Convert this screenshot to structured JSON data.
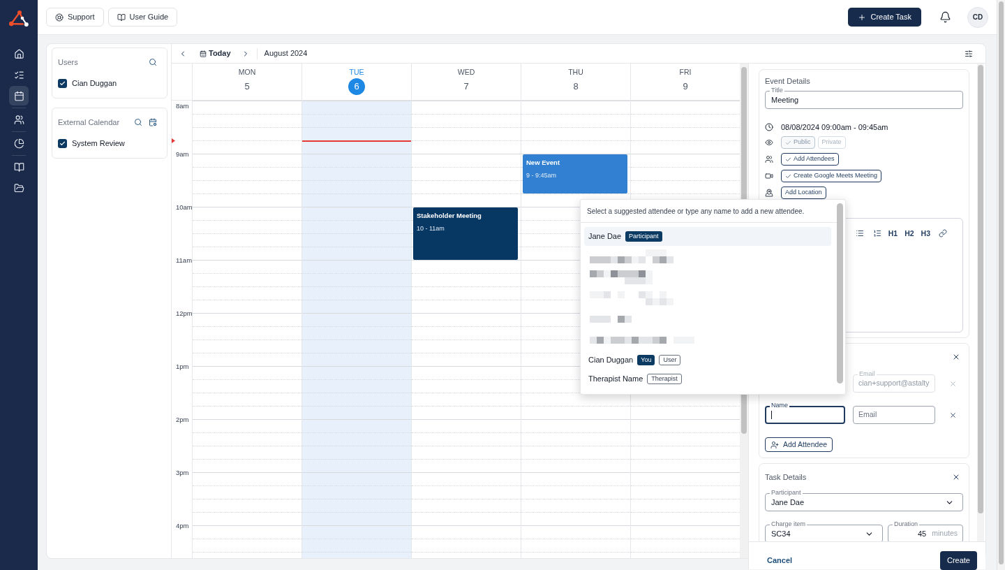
{
  "top_bar": {
    "links": [
      {
        "label": "Support"
      },
      {
        "label": "User Guide"
      }
    ],
    "create_button": "Create Task",
    "avatar": "CD"
  },
  "sidebar": {
    "groups": [
      [
        {
          "selected": false
        },
        {
          "selected": false
        },
        {
          "selected": true
        }
      ],
      [
        {
          "selected": false
        }
      ],
      [
        {
          "selected": false
        }
      ],
      [
        {
          "selected": false
        },
        {
          "selected": false
        }
      ]
    ]
  },
  "filters": [
    {
      "title": "Users",
      "items": [
        {
          "label": "Cian Duggan",
          "checked": true
        }
      ]
    },
    {
      "title": "External Calendar",
      "items": [
        {
          "label": "System Review",
          "checked": true
        }
      ]
    }
  ],
  "calendar": {
    "today_button": "Today",
    "month": "August 2024",
    "hours": [
      {
        "label": "8am",
        "quarters": [
          {
            "now": false
          },
          {
            "now": false
          },
          {
            "now": false
          },
          {
            "now": true
          }
        ]
      },
      {
        "label": "9am",
        "quarters": [
          {
            "now": false
          },
          {
            "now": false
          },
          {
            "now": false
          },
          {
            "now": false
          }
        ]
      },
      {
        "label": "10am",
        "quarters": [
          {
            "now": false
          },
          {
            "now": false
          },
          {
            "now": false
          },
          {
            "now": false
          }
        ]
      },
      {
        "label": "11am",
        "quarters": [
          {
            "now": false
          },
          {
            "now": false
          },
          {
            "now": false
          },
          {
            "now": false
          }
        ]
      },
      {
        "label": "12pm",
        "quarters": [
          {
            "now": false
          },
          {
            "now": false
          },
          {
            "now": false
          },
          {
            "now": false
          }
        ]
      },
      {
        "label": "1pm",
        "quarters": [
          {
            "now": false
          },
          {
            "now": false
          },
          {
            "now": false
          },
          {
            "now": false
          }
        ]
      },
      {
        "label": "2pm",
        "quarters": [
          {
            "now": false
          },
          {
            "now": false
          },
          {
            "now": false
          },
          {
            "now": false
          }
        ]
      },
      {
        "label": "3pm",
        "quarters": [
          {
            "now": false
          },
          {
            "now": false
          },
          {
            "now": false
          },
          {
            "now": false
          }
        ]
      },
      {
        "label": "4pm",
        "quarters": [
          {
            "now": false
          },
          {
            "now": false
          },
          {
            "now": false
          }
        ]
      }
    ],
    "days": [
      {
        "name": "MON",
        "date": "5",
        "today": false
      },
      {
        "name": "TUE",
        "date": "6",
        "today": true
      },
      {
        "name": "WED",
        "date": "7",
        "today": false,
        "events": [
          {
            "title": "Stakeholder Meeting",
            "time": "10 - 11am",
            "color": "#073763"
          }
        ]
      },
      {
        "name": "THU",
        "date": "8",
        "today": false,
        "events": [
          {
            "title": "New Event",
            "time": "9 - 9:45am",
            "color": "#3180d1"
          }
        ]
      },
      {
        "name": "FRI",
        "date": "9",
        "today": false
      }
    ]
  },
  "event_panel": {
    "event_details": {
      "heading": "Event Details",
      "title_field": {
        "label": "Title",
        "value": "Meeting"
      },
      "datetime": "08/08/2024 09:00am - 09:45am",
      "option_rows": [
        {
          "chips": [
            {
              "label": "Public",
              "selected": true,
              "disabled": true
            },
            {
              "label": "Private",
              "selected": false,
              "disabled": true
            }
          ]
        },
        {
          "chips": [
            {
              "label": "Add Attendees",
              "selected": true,
              "disabled": false
            }
          ]
        },
        {
          "chips": [
            {
              "label": "Create Google Meets Meeting",
              "selected": true,
              "disabled": false
            }
          ]
        },
        {
          "chips": [
            {
              "label": "Add Location",
              "selected": false,
              "disabled": false
            }
          ]
        }
      ],
      "editor": {
        "headings": [
          "H1",
          "H2",
          "H3"
        ]
      }
    },
    "attendees": {
      "rows": [
        {
          "email": {
            "label": "Email",
            "value": "cian+support@astalty",
            "disabled": true
          },
          "removable": false
        },
        {
          "name": {
            "label": "Name",
            "focused": true
          },
          "email": {
            "placeholder": "Email",
            "disabled": false
          },
          "removable": true
        }
      ],
      "add_button": "Add Attendee"
    },
    "task_details": {
      "heading": "Task Details",
      "participant": {
        "label": "Participant",
        "value": "Jane Dae"
      },
      "charge_item": {
        "label": "Charge item",
        "value": "SC34"
      },
      "duration": {
        "label": "Duration",
        "value": "45",
        "unit": "minutes"
      }
    },
    "footer": {
      "cancel": "Cancel",
      "create": "Create"
    }
  },
  "attendee_dropdown": {
    "hint": "Select a suggested attendee or type any name to add a new attendee.",
    "options": [
      {
        "kind": "person",
        "name": "Jane Dae",
        "selected": true,
        "badges": [
          {
            "label": "Participant",
            "filled": true
          }
        ]
      },
      {
        "kind": "redacted",
        "selected": false
      },
      {
        "kind": "redacted",
        "selected": false
      },
      {
        "kind": "redacted",
        "selected": false
      },
      {
        "kind": "redacted",
        "selected": false
      },
      {
        "kind": "redacted",
        "selected": false
      },
      {
        "kind": "person",
        "name": "Cian Duggan",
        "selected": false,
        "badges": [
          {
            "label": "You",
            "filled": true
          },
          {
            "label": "User",
            "filled": false
          }
        ]
      },
      {
        "kind": "person",
        "name": "Therapist Name",
        "selected": false,
        "badges": [
          {
            "label": "Therapist",
            "filled": false
          }
        ]
      }
    ]
  }
}
